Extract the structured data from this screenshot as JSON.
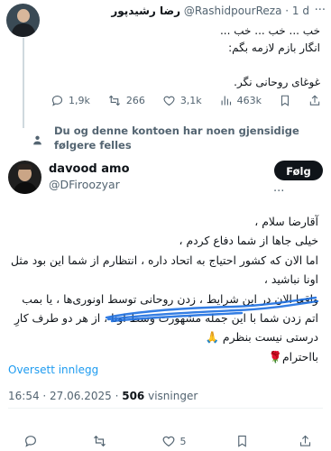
{
  "quoted_tweet": {
    "display_name": "رضا رشیدپور",
    "handle": "@RashidpourReza",
    "time": "1 d",
    "separator": "·",
    "text": "خب ... خب ... خب ...\nانگار بازم لازمه بگم:\n\nغوغای روحانی نگر.",
    "actions": {
      "replies": "1,9k",
      "reposts": "266",
      "likes": "3,1k",
      "views": "463k"
    }
  },
  "followers_note": "Du og denne kontoen har noen gjensidige følgere felles",
  "author": {
    "display_name": "davood amo",
    "handle": "@DFiroozyar",
    "follow_label": "Følg"
  },
  "tweet": {
    "text": "آقارضا سلام ،\nخیلی جاها از شما دفاع کردم ،\nاما الان که کشور احتیاج به اتحاد داره ، انتظارم از شما این بود مثل اونا نباشید ،\nواقعا الان در این شرایط ، زدن روحانی توسط اونوری‌ها ، یا بمب اتم زدن شما با این جمله مشهورت وسط اونا ، از هر دو طرف کارِ درستی نیست بنظرم 🙏\nبااحترام🌹",
    "translate_label": "Oversett innlegg",
    "time": "16:54",
    "date": "27.06.2025",
    "views_count": "506",
    "views_label": "visninger"
  },
  "bottom_actions": {
    "replies": "",
    "reposts": "",
    "likes": "5"
  },
  "colors": {
    "accent": "#1d9bf0",
    "text": "#0f1419",
    "muted": "#536471",
    "scribble": "#1d6fe0"
  }
}
